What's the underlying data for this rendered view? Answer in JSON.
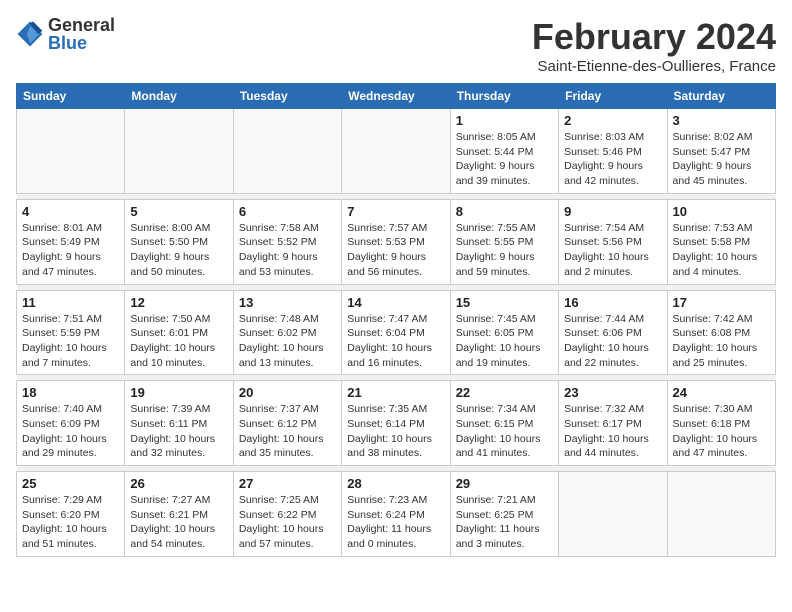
{
  "header": {
    "logo_general": "General",
    "logo_blue": "Blue",
    "month_title": "February 2024",
    "location": "Saint-Etienne-des-Oullieres, France"
  },
  "days_of_week": [
    "Sunday",
    "Monday",
    "Tuesday",
    "Wednesday",
    "Thursday",
    "Friday",
    "Saturday"
  ],
  "weeks": [
    [
      {
        "day": "",
        "info": ""
      },
      {
        "day": "",
        "info": ""
      },
      {
        "day": "",
        "info": ""
      },
      {
        "day": "",
        "info": ""
      },
      {
        "day": "1",
        "info": "Sunrise: 8:05 AM\nSunset: 5:44 PM\nDaylight: 9 hours and 39 minutes."
      },
      {
        "day": "2",
        "info": "Sunrise: 8:03 AM\nSunset: 5:46 PM\nDaylight: 9 hours and 42 minutes."
      },
      {
        "day": "3",
        "info": "Sunrise: 8:02 AM\nSunset: 5:47 PM\nDaylight: 9 hours and 45 minutes."
      }
    ],
    [
      {
        "day": "4",
        "info": "Sunrise: 8:01 AM\nSunset: 5:49 PM\nDaylight: 9 hours and 47 minutes."
      },
      {
        "day": "5",
        "info": "Sunrise: 8:00 AM\nSunset: 5:50 PM\nDaylight: 9 hours and 50 minutes."
      },
      {
        "day": "6",
        "info": "Sunrise: 7:58 AM\nSunset: 5:52 PM\nDaylight: 9 hours and 53 minutes."
      },
      {
        "day": "7",
        "info": "Sunrise: 7:57 AM\nSunset: 5:53 PM\nDaylight: 9 hours and 56 minutes."
      },
      {
        "day": "8",
        "info": "Sunrise: 7:55 AM\nSunset: 5:55 PM\nDaylight: 9 hours and 59 minutes."
      },
      {
        "day": "9",
        "info": "Sunrise: 7:54 AM\nSunset: 5:56 PM\nDaylight: 10 hours and 2 minutes."
      },
      {
        "day": "10",
        "info": "Sunrise: 7:53 AM\nSunset: 5:58 PM\nDaylight: 10 hours and 4 minutes."
      }
    ],
    [
      {
        "day": "11",
        "info": "Sunrise: 7:51 AM\nSunset: 5:59 PM\nDaylight: 10 hours and 7 minutes."
      },
      {
        "day": "12",
        "info": "Sunrise: 7:50 AM\nSunset: 6:01 PM\nDaylight: 10 hours and 10 minutes."
      },
      {
        "day": "13",
        "info": "Sunrise: 7:48 AM\nSunset: 6:02 PM\nDaylight: 10 hours and 13 minutes."
      },
      {
        "day": "14",
        "info": "Sunrise: 7:47 AM\nSunset: 6:04 PM\nDaylight: 10 hours and 16 minutes."
      },
      {
        "day": "15",
        "info": "Sunrise: 7:45 AM\nSunset: 6:05 PM\nDaylight: 10 hours and 19 minutes."
      },
      {
        "day": "16",
        "info": "Sunrise: 7:44 AM\nSunset: 6:06 PM\nDaylight: 10 hours and 22 minutes."
      },
      {
        "day": "17",
        "info": "Sunrise: 7:42 AM\nSunset: 6:08 PM\nDaylight: 10 hours and 25 minutes."
      }
    ],
    [
      {
        "day": "18",
        "info": "Sunrise: 7:40 AM\nSunset: 6:09 PM\nDaylight: 10 hours and 29 minutes."
      },
      {
        "day": "19",
        "info": "Sunrise: 7:39 AM\nSunset: 6:11 PM\nDaylight: 10 hours and 32 minutes."
      },
      {
        "day": "20",
        "info": "Sunrise: 7:37 AM\nSunset: 6:12 PM\nDaylight: 10 hours and 35 minutes."
      },
      {
        "day": "21",
        "info": "Sunrise: 7:35 AM\nSunset: 6:14 PM\nDaylight: 10 hours and 38 minutes."
      },
      {
        "day": "22",
        "info": "Sunrise: 7:34 AM\nSunset: 6:15 PM\nDaylight: 10 hours and 41 minutes."
      },
      {
        "day": "23",
        "info": "Sunrise: 7:32 AM\nSunset: 6:17 PM\nDaylight: 10 hours and 44 minutes."
      },
      {
        "day": "24",
        "info": "Sunrise: 7:30 AM\nSunset: 6:18 PM\nDaylight: 10 hours and 47 minutes."
      }
    ],
    [
      {
        "day": "25",
        "info": "Sunrise: 7:29 AM\nSunset: 6:20 PM\nDaylight: 10 hours and 51 minutes."
      },
      {
        "day": "26",
        "info": "Sunrise: 7:27 AM\nSunset: 6:21 PM\nDaylight: 10 hours and 54 minutes."
      },
      {
        "day": "27",
        "info": "Sunrise: 7:25 AM\nSunset: 6:22 PM\nDaylight: 10 hours and 57 minutes."
      },
      {
        "day": "28",
        "info": "Sunrise: 7:23 AM\nSunset: 6:24 PM\nDaylight: 11 hours and 0 minutes."
      },
      {
        "day": "29",
        "info": "Sunrise: 7:21 AM\nSunset: 6:25 PM\nDaylight: 11 hours and 3 minutes."
      },
      {
        "day": "",
        "info": ""
      },
      {
        "day": "",
        "info": ""
      }
    ]
  ]
}
